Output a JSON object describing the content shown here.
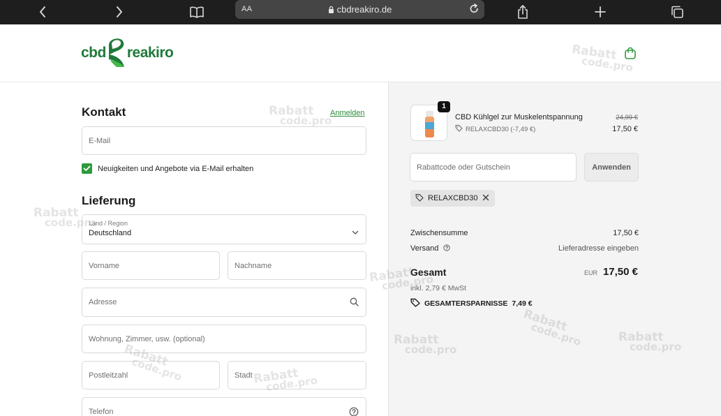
{
  "browser": {
    "aa_label": "AA",
    "url": "cbdreakiro.de"
  },
  "header": {
    "logo_part1": "cbd",
    "logo_part2": "reakiro"
  },
  "contact": {
    "title": "Kontakt",
    "login_link": "Anmelden",
    "email_placeholder": "E-Mail",
    "newsletter_label": "Neuigkeiten und Angebote via E-Mail erhalten"
  },
  "delivery": {
    "title": "Lieferung",
    "country_label": "Land / Region",
    "country_value": "Deutschland",
    "first_name_placeholder": "Vorname",
    "last_name_placeholder": "Nachname",
    "address_placeholder": "Adresse",
    "apartment_placeholder": "Wohnung, Zimmer, usw. (optional)",
    "zip_placeholder": "Postleitzahl",
    "city_placeholder": "Stadt",
    "phone_placeholder": "Telefon"
  },
  "cart": {
    "item_quantity": "1",
    "product_name": "CBD Kühlgel zur Muskelentspannung",
    "product_discount": "RELAXCBD30 (-7,49 €)",
    "price_old": "24,99 €",
    "price_new": "17,50 €",
    "discount_placeholder": "Rabattcode oder Gutschein",
    "apply_label": "Anwenden",
    "applied_code": "RELAXCBD30"
  },
  "summary": {
    "subtotal_label": "Zwischensumme",
    "subtotal_value": "17,50 €",
    "shipping_label": "Versand",
    "shipping_value": "Lieferadresse eingeben",
    "total_label": "Gesamt",
    "total_currency": "EUR",
    "total_value": "17,50 €",
    "tax_note": "inkl. 2,79 € MwSt",
    "savings_label": "GESAMTERSPARNISSE",
    "savings_value": "7,49 €"
  },
  "watermark": {
    "line1": "Rabatt",
    "line2": "code.pro"
  },
  "colors": {
    "accent_green": "#2e9a3c",
    "toolbar_bg": "#1e1e1e",
    "summary_bg": "#f4f4f4"
  }
}
